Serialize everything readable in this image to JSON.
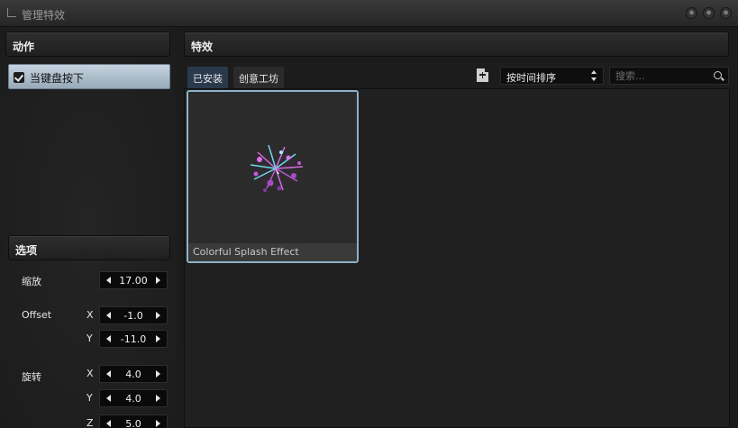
{
  "window": {
    "title": "管理特效"
  },
  "actions": {
    "header": "动作",
    "items": [
      {
        "label": "当键盘按下",
        "checked": true
      }
    ]
  },
  "options": {
    "header": "选项",
    "scale": {
      "label": "缩放",
      "value": "17.00"
    },
    "offset": {
      "label": "Offset",
      "x_label": "X",
      "x": "-1.0",
      "y_label": "Y",
      "y": "-11.0"
    },
    "rotation": {
      "label": "旋转",
      "x_label": "X",
      "x": "4.0",
      "y_label": "Y",
      "y": "4.0",
      "z_label": "Z",
      "z": "5.0"
    }
  },
  "effects": {
    "header": "特效",
    "tabs": [
      {
        "label": "已安装",
        "active": true
      },
      {
        "label": "创意工坊",
        "active": false
      }
    ],
    "sort": {
      "selected": "按时间排序"
    },
    "search": {
      "placeholder": "搜索..."
    },
    "items": [
      {
        "title": "Colorful Splash Effect",
        "selected": true
      }
    ]
  },
  "colors": {
    "selection": "#8eb0c8",
    "active_tab": "#2a3a4c",
    "action_highlight": "#b3c3cf"
  }
}
